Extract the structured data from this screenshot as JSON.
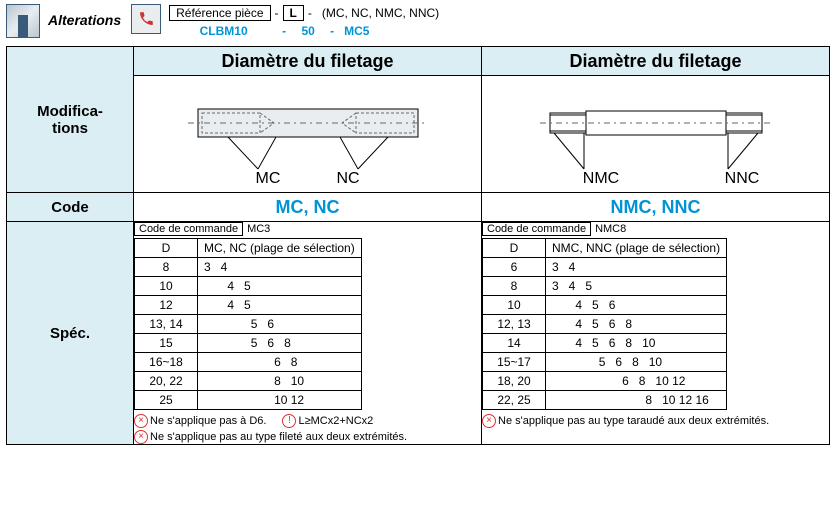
{
  "top": {
    "alterations_label": "Alterations",
    "ref_piece_label": "Référence pièce",
    "L_label": "L",
    "codes_hint": "(MC, NC, NMC, NNC)",
    "example_ref": "CLBM10",
    "example_L": "50",
    "example_code": "MC5",
    "sep": "-"
  },
  "headers": {
    "modifications": "Modifica-\ntions",
    "diam_left": "Diamètre du filetage",
    "diam_right": "Diamètre du filetage",
    "code": "Code",
    "spec": "Spéc."
  },
  "diagram": {
    "left_labels": {
      "mc": "MC",
      "nc": "NC"
    },
    "right_labels": {
      "nmc": "NMC",
      "nnc": "NNC"
    }
  },
  "codes": {
    "left": "MC, NC",
    "right": "NMC, NNC"
  },
  "spec_left": {
    "cmd_label": "Code de commande",
    "cmd_example": "MC3",
    "col_d": "D",
    "col_range": "MC, NC (plage de sélection)",
    "rows": [
      {
        "d": "8",
        "vals": [
          "3",
          "4",
          "",
          "",
          ""
        ]
      },
      {
        "d": "10",
        "vals": [
          "",
          "4",
          "5",
          "",
          ""
        ]
      },
      {
        "d": "12",
        "vals": [
          "",
          "4",
          "5",
          "",
          ""
        ]
      },
      {
        "d": "13, 14",
        "vals": [
          "",
          "",
          "5",
          "6",
          ""
        ]
      },
      {
        "d": "15",
        "vals": [
          "",
          "",
          "5",
          "6",
          "8"
        ]
      },
      {
        "d": "16~18",
        "vals": [
          "",
          "",
          "",
          "6",
          "8"
        ]
      },
      {
        "d": "20, 22",
        "vals": [
          "",
          "",
          "",
          "8",
          "10"
        ]
      },
      {
        "d": "25",
        "vals": [
          "",
          "",
          "",
          "10",
          "12"
        ]
      }
    ],
    "notes": [
      "Ne s'applique pas à D6.",
      "L≥MCx2+NCx2",
      "Ne s'applique pas au type fileté aux deux extrémités."
    ]
  },
  "spec_right": {
    "cmd_label": "Code de commande",
    "cmd_example": "NMC8",
    "col_d": "D",
    "col_range": "NMC, NNC (plage de sélection)",
    "rows": [
      {
        "d": "6",
        "vals": [
          "3",
          "4",
          "",
          "",
          "",
          ""
        ]
      },
      {
        "d": "8",
        "vals": [
          "3",
          "4",
          "5",
          "",
          "",
          ""
        ]
      },
      {
        "d": "10",
        "vals": [
          "",
          "4",
          "5",
          "6",
          "",
          ""
        ]
      },
      {
        "d": "12, 13",
        "vals": [
          "",
          "4",
          "5",
          "6",
          "8",
          ""
        ]
      },
      {
        "d": "14",
        "vals": [
          "",
          "4",
          "5",
          "6",
          "8",
          "10"
        ]
      },
      {
        "d": "15~17",
        "vals": [
          "",
          "",
          "5",
          "6",
          "8",
          "10"
        ]
      },
      {
        "d": "18, 20",
        "vals": [
          "",
          "",
          "",
          "6",
          "8",
          "10",
          "12"
        ]
      },
      {
        "d": "22, 25",
        "vals": [
          "",
          "",
          "",
          "",
          "8",
          "10",
          "12",
          "16"
        ]
      }
    ],
    "notes": [
      "Ne s'applique pas au type taraudé aux deux extrémités."
    ]
  }
}
